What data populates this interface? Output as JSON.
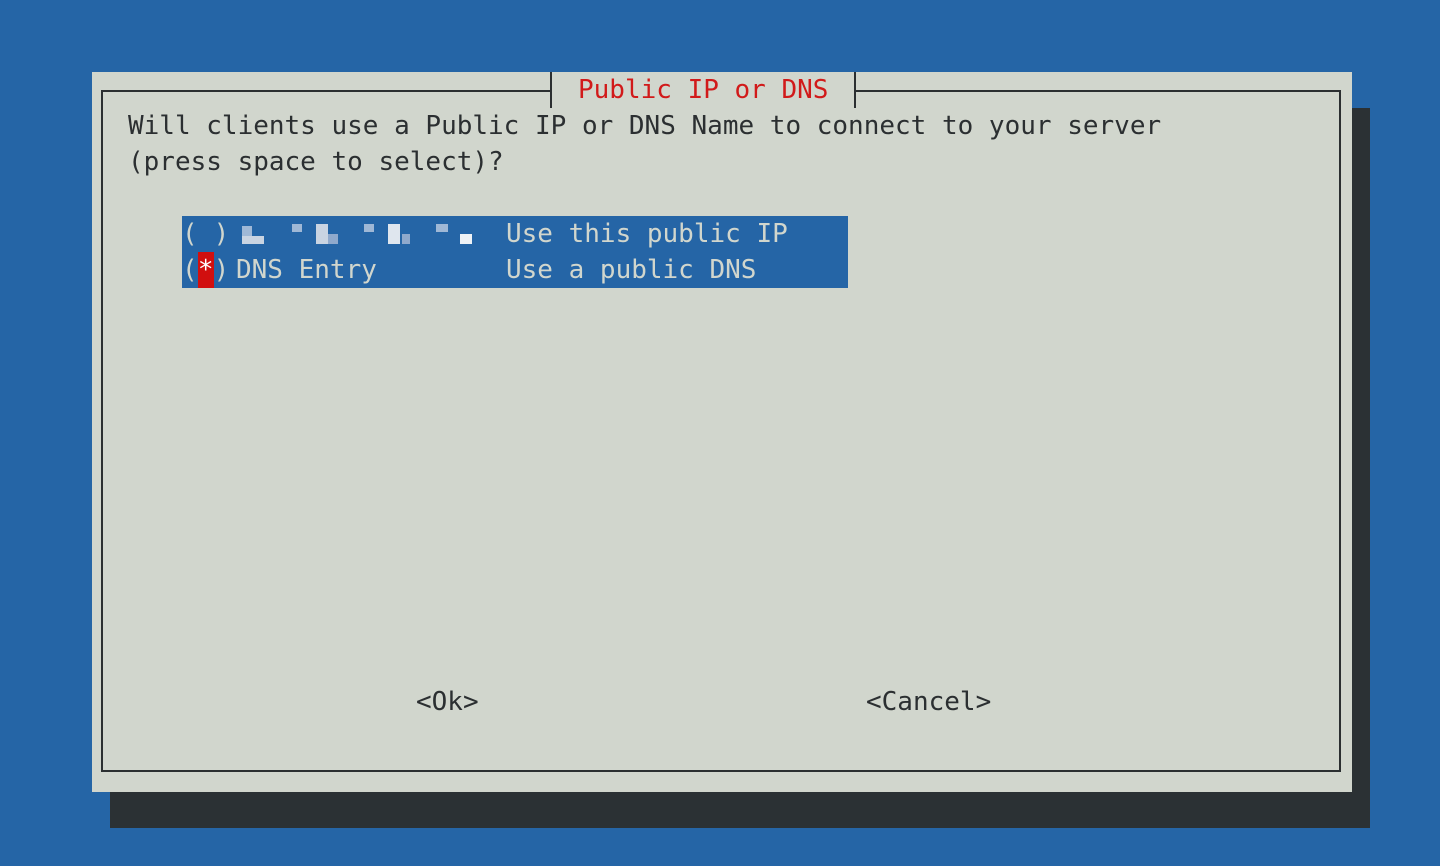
{
  "dialog": {
    "title": "Public IP or DNS",
    "prompt_line1": "Will clients use a Public IP or DNS Name to connect to your server",
    "prompt_line2": "(press space to select)?"
  },
  "options": [
    {
      "radio_open": "(",
      "radio_mark": " ",
      "radio_close": ")",
      "tag": "",
      "tag_redacted": true,
      "description": "Use this public IP",
      "selected": false
    },
    {
      "radio_open": "(",
      "radio_mark": "*",
      "radio_close": ")",
      "tag": "DNS Entry",
      "tag_redacted": false,
      "description": "Use a public DNS",
      "selected": true
    }
  ],
  "buttons": {
    "ok_label": "<Ok>",
    "cancel_label": "<Cancel>"
  },
  "colors": {
    "background": "#2565a6",
    "dialog": "#d1d6cd",
    "title_text": "#d11a1a",
    "selected_mark": "#d10f0f",
    "shadow": "#2b3134"
  }
}
